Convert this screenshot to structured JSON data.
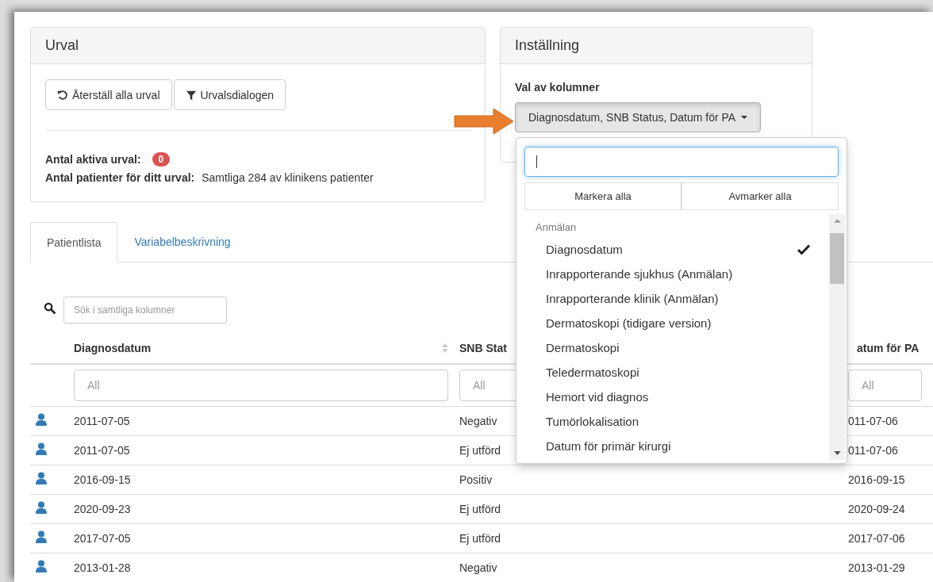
{
  "urval_panel": {
    "title": "Urval",
    "buttons": [
      {
        "label": "Återställ alla urval",
        "kind": "reset"
      },
      {
        "label": "Urvalsdialogen",
        "kind": "filter"
      }
    ],
    "active_label": "Antal aktiva urval:",
    "active_count": "0",
    "patients_label": "Antal patienter för ditt urval:",
    "patients_value": "Samtliga 284 av klinikens patienter"
  },
  "settings_panel": {
    "title": "Inställning",
    "field_label": "Val av kolumner",
    "dropdown_value": "Diagnosdatum, SNB Status, Datum för PA",
    "expanded": true
  },
  "column_menu": {
    "select_all": "Markera alla",
    "deselect_all": "Avmarker alla",
    "group": "Anmälan",
    "items": [
      {
        "label": "Diagnosdatum",
        "checked": true
      },
      {
        "label": "Inrapporterande sjukhus (Anmälan)",
        "checked": false
      },
      {
        "label": "Inrapporterande klinik (Anmälan)",
        "checked": false
      },
      {
        "label": "Dermatoskopi (tidigare version)",
        "checked": false
      },
      {
        "label": "Dermatoskopi",
        "checked": false
      },
      {
        "label": "Teledermatoskopi",
        "checked": false
      },
      {
        "label": "Hemort vid diagnos",
        "checked": false
      },
      {
        "label": "Tumörlokalisation",
        "checked": false
      },
      {
        "label": "Datum för primär kirurgi",
        "checked": false
      }
    ]
  },
  "tabs": [
    {
      "label": "Patientlista",
      "selected": true
    },
    {
      "label": "Variabelbeskrivning",
      "selected": false
    }
  ],
  "table": {
    "search_placeholder": "Sök i samtliga kolumner",
    "columns": [
      "Diagnosdatum",
      "SNB Stat",
      "atum för PA"
    ],
    "filters": [
      {
        "placeholder": "All"
      },
      {
        "placeholder": "All"
      },
      {
        "placeholder": "All"
      }
    ],
    "rows": [
      [
        "2011-07-05",
        "Negativ",
        "011-07-06"
      ],
      [
        "2011-07-05",
        "Ej utförd",
        "011-07-06"
      ],
      [
        "2016-09-15",
        "Positiv",
        "2016-09-15"
      ],
      [
        "2020-09-23",
        "Ej utförd",
        "2020-09-24"
      ],
      [
        "2017-07-05",
        "Ej utförd",
        "2017-07-06"
      ],
      [
        "2013-01-28",
        "Negativ",
        "2013-01-29"
      ]
    ]
  }
}
